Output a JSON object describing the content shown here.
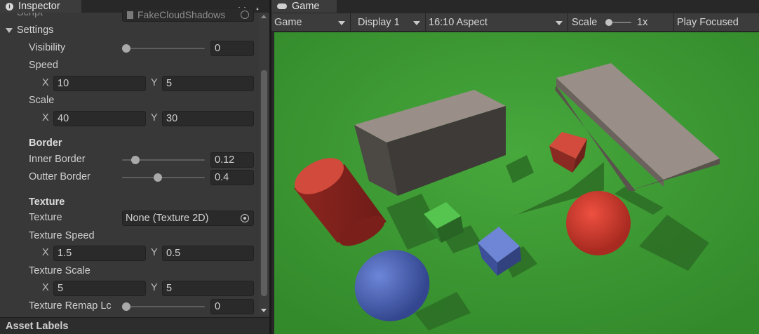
{
  "inspector": {
    "tab_label": "Inspector",
    "tab_icon": "info-icon",
    "lock_icon": "lock-icon",
    "menu_icon": "kebab-menu-icon",
    "script": {
      "label": "Script",
      "value": "FakeCloudShadows"
    },
    "settings_label": "Settings",
    "visibility": {
      "label": "Visibility",
      "value": "0",
      "fraction": 0.0
    },
    "speed": {
      "label": "Speed",
      "x_label": "X",
      "x": "10",
      "y_label": "Y",
      "y": "5"
    },
    "scale": {
      "label": "Scale",
      "x_label": "X",
      "x": "40",
      "y_label": "Y",
      "y": "30"
    },
    "border_header": "Border",
    "inner_border": {
      "label": "Inner Border",
      "value": "0.12",
      "fraction": 0.12
    },
    "outter_border": {
      "label": "Outter Border",
      "value": "0.4",
      "fraction": 0.4
    },
    "texture_header": "Texture",
    "texture": {
      "label": "Texture",
      "value": "None (Texture 2D)"
    },
    "texture_speed": {
      "label": "Texture Speed",
      "x_label": "X",
      "x": "1.5",
      "y_label": "Y",
      "y": "0.5"
    },
    "texture_scale": {
      "label": "Texture Scale",
      "x_label": "X",
      "x": "5",
      "y_label": "Y",
      "y": "5"
    },
    "texture_remap": {
      "label": "Texture Remap Lc",
      "value": "0",
      "fraction": 0.0
    },
    "asset_labels": "Asset Labels"
  },
  "game": {
    "tab_label": "Game",
    "tab_icon": "gamepad-icon",
    "toolbar": {
      "view": "Game",
      "display": "Display 1",
      "aspect": "16:10 Aspect",
      "scale_label": "Scale",
      "scale_value": "1x",
      "play_mode": "Play Focused"
    }
  },
  "colors": {
    "ground": "#3f9a35",
    "red_object": "#c93a2f",
    "green_cube": "#4cb84a",
    "blue_object": "#5a73c8",
    "gray_block": "#9a8f88"
  }
}
